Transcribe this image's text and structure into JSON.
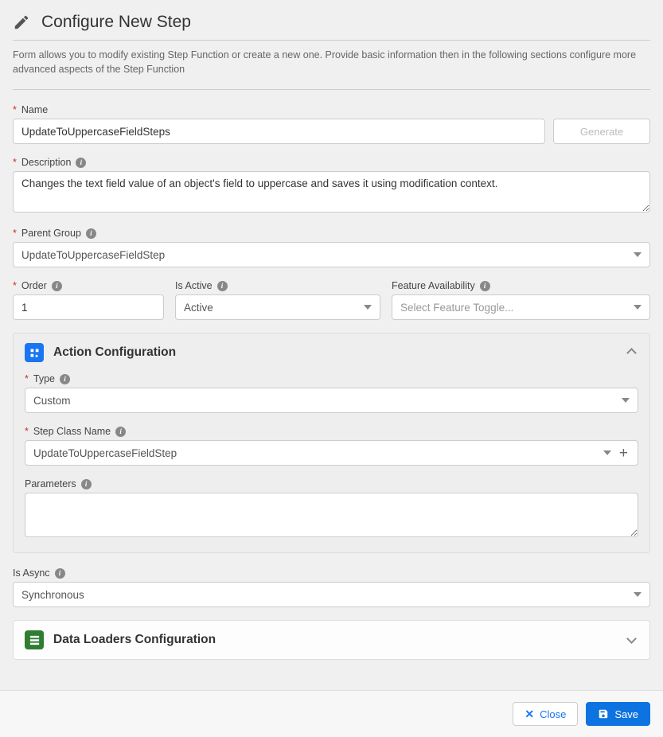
{
  "header": {
    "title": "Configure New Step",
    "intro": "Form allows you to modify existing Step Function or create a new one. Provide basic information then in the following sections configure more advanced aspects of the Step Function"
  },
  "name": {
    "label": "Name",
    "value": "UpdateToUppercaseFieldSteps",
    "generate_label": "Generate"
  },
  "description": {
    "label": "Description",
    "value": "Changes the text field value of an object's field to uppercase and saves it using modification context."
  },
  "parent_group": {
    "label": "Parent Group",
    "value": "UpdateToUppercaseFieldStep"
  },
  "order": {
    "label": "Order",
    "value": "1"
  },
  "is_active": {
    "label": "Is Active",
    "value": "Active"
  },
  "feature_avail": {
    "label": "Feature Availability",
    "placeholder": "Select Feature Toggle..."
  },
  "action_panel": {
    "title": "Action Configuration",
    "type": {
      "label": "Type",
      "value": "Custom"
    },
    "step_class": {
      "label": "Step Class Name",
      "value": "UpdateToUppercaseFieldStep"
    },
    "parameters": {
      "label": "Parameters",
      "value": ""
    }
  },
  "is_async": {
    "label": "Is Async",
    "value": "Synchronous"
  },
  "data_loaders_panel": {
    "title": "Data Loaders Configuration"
  },
  "footer": {
    "close": "Close",
    "save": "Save"
  }
}
